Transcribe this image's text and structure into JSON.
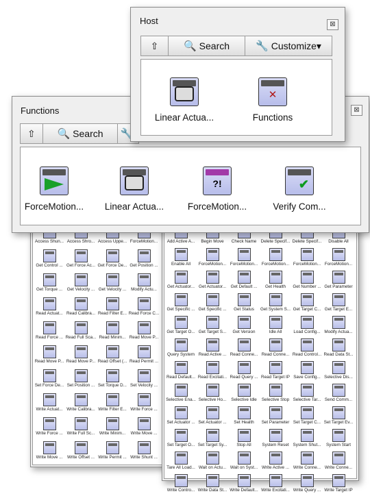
{
  "host": {
    "title": "Host",
    "toolbar": {
      "up_label": "⇧",
      "search_label": "Search",
      "customize_label": "Customize▾"
    },
    "items": [
      {
        "label": "Linear Actua...",
        "icon": "linear-actuator-icon"
      },
      {
        "label": "Functions",
        "icon": "functions-tools-icon"
      }
    ]
  },
  "functions": {
    "title": "Functions",
    "toolbar": {
      "up_label": "⇧",
      "search_label": "Search"
    },
    "items": [
      {
        "label": "ForceMotion...",
        "icon": "forcemotion-play-icon"
      },
      {
        "label": "Linear Actua...",
        "icon": "linear-actuator-icon"
      },
      {
        "label": "ForceMotion...",
        "icon": "forcemotion-error-icon"
      },
      {
        "label": "Verify Com...",
        "icon": "verify-communication-icon"
      }
    ]
  },
  "left_palette": {
    "items": [
      "Access Shun...",
      "Access Shro...",
      "Access Uppe...",
      "ForceMotion...",
      "Get Control ...",
      "Get Force Ac...",
      "Get Force De...",
      "Get Position ...",
      "Get Torque ...",
      "Get Velocity ...",
      "Get Velocity ...",
      "Modify Actu...",
      "Read Actuat...",
      "Read Calibra...",
      "Read Filter E...",
      "Read Force C...",
      "Read Force ...",
      "Read Full Sca...",
      "Read Minim...",
      "Read Move P...",
      "Read Move P...",
      "Read Move P...",
      "Read Offset (...",
      "Read Permit ...",
      "Set Force De...",
      "Set Position ...",
      "Set Torque D...",
      "Set Velocity ...",
      "Write Actuat...",
      "Write Calibra...",
      "Write Filter E...",
      "Write Force ...",
      "Write Force ...",
      "Write Full Sc...",
      "Write Minim...",
      "Write Move ...",
      "Write Move ...",
      "Write Offset ...",
      "Write Permit ...",
      "Write Shunt ..."
    ]
  },
  "right_palette": {
    "items": [
      "Add Active A...",
      "Begin Move",
      "Check Name",
      "Delete Specif...",
      "Delete Specif...",
      "Disable All",
      "Enable All",
      "ForceMotion...",
      "ForceMotion...",
      "ForceMotion...",
      "ForceMotion...",
      "ForceMotion...",
      "Get Actuator...",
      "Get Actuator...",
      "Get Default ...",
      "Get Health",
      "Get Number ...",
      "Get Parameter",
      "Get Specific ...",
      "Get Specific ...",
      "Get Status",
      "Get System S...",
      "Get Target C...",
      "Get Target E...",
      "Get Target O...",
      "Get Target S...",
      "Get Version",
      "Idle All",
      "Load Config...",
      "Modify Actua...",
      "Query System",
      "Read Active ...",
      "Read Conne...",
      "Read Conne...",
      "Read Control...",
      "Read Data St...",
      "Read Default...",
      "Read Excitati...",
      "Read Query ...",
      "Read Target IP",
      "Save Config...",
      "Selective Dis...",
      "Selective Ena...",
      "Selective Ho...",
      "Selective Idle",
      "Selective Stop",
      "Selective Tar...",
      "Send Comm...",
      "Set Actuator ...",
      "Set Actuator ...",
      "Set Health",
      "Set Parameter",
      "Set Target C...",
      "Set Target Ev...",
      "Set Target O...",
      "Set Target Sy...",
      "Stop All",
      "System Reset",
      "System Shut...",
      "System Start",
      "Tare All Load...",
      "Wait on Actu...",
      "Wait on Syst...",
      "Write Active ...",
      "Write Conne...",
      "Write Conne...",
      "Write Contro...",
      "Write Data St...",
      "Write Default...",
      "Write Excitati...",
      "Write Query ...",
      "Write Target IP"
    ]
  }
}
